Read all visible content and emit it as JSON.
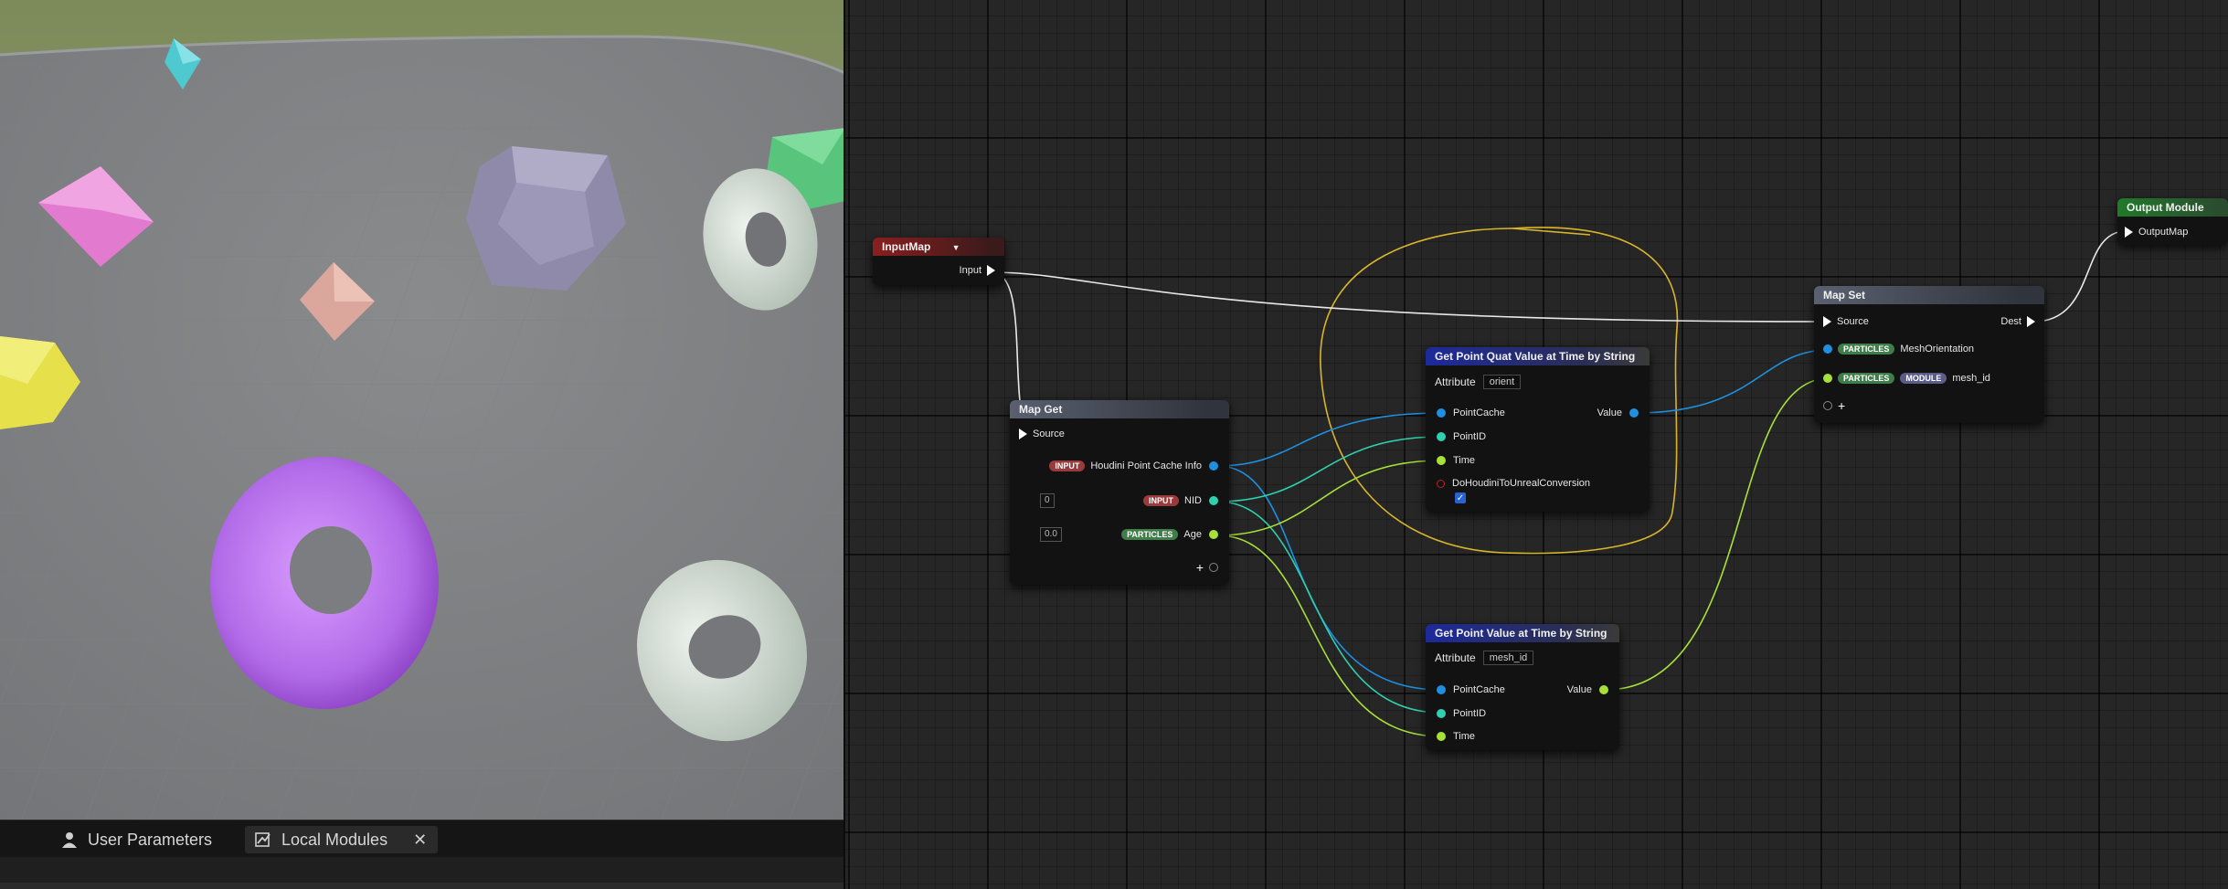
{
  "tabs": [
    {
      "label": "User Parameters",
      "icon": "user-icon",
      "active": false
    },
    {
      "label": "Local Modules",
      "icon": "graph-icon",
      "active": true,
      "closable": true
    }
  ],
  "nodes": {
    "input_map": {
      "title": "InputMap",
      "pin_input": "Input"
    },
    "map_get": {
      "title": "Map Get",
      "source": "Source",
      "rows": [
        {
          "tag": "INPUT",
          "label": "Houdini Point Cache Info"
        },
        {
          "tag": "INPUT",
          "label": "NID",
          "default": "0"
        },
        {
          "tag": "PARTICLES",
          "label": "Age",
          "default": "0.0"
        }
      ]
    },
    "quat": {
      "title": "Get Point Quat Value at Time by String",
      "attribute_label": "Attribute",
      "attribute_value": "orient",
      "pins": [
        "PointCache",
        "PointID",
        "Time",
        "DoHoudiniToUnrealConversion"
      ],
      "output": "Value",
      "checkbox": true
    },
    "value": {
      "title": "Get Point Value at Time by String",
      "attribute_label": "Attribute",
      "attribute_value": "mesh_id",
      "pins": [
        "PointCache",
        "PointID",
        "Time"
      ],
      "output": "Value"
    },
    "map_set": {
      "title": "Map Set",
      "source": "Source",
      "dest": "Dest",
      "rows": [
        {
          "tags": [
            "PARTICLES"
          ],
          "label": "MeshOrientation"
        },
        {
          "tags": [
            "PARTICLES",
            "MODULE"
          ],
          "label": "mesh_id"
        }
      ]
    },
    "output": {
      "title": "Output Module",
      "pin": "OutputMap"
    }
  },
  "colors": {
    "pointcache_wire": "#1e90e0",
    "int_wire": "#2fd0b0",
    "float_wire": "#a8e03a",
    "exec_wire": "#e8e8e8",
    "comment_outline": "#d9b52a"
  }
}
